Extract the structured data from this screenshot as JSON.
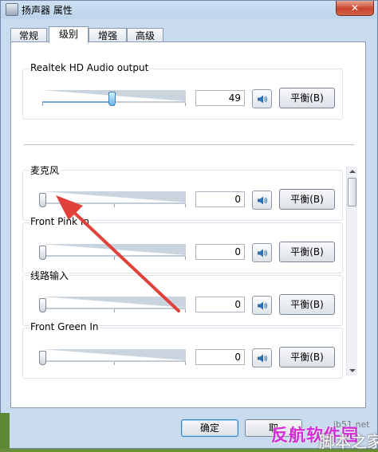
{
  "window": {
    "title": "扬声器 属性",
    "close_label": "✕"
  },
  "tabs": [
    {
      "label": "常规",
      "active": false
    },
    {
      "label": "级别",
      "active": true
    },
    {
      "label": "增强",
      "active": false
    },
    {
      "label": "高级",
      "active": false
    }
  ],
  "master": {
    "label": "Realtek HD Audio output",
    "value": "49",
    "level_percent": 49,
    "balance_label": "平衡(B)"
  },
  "channels": [
    {
      "label": "麦克风",
      "value": "0",
      "level_percent": 0,
      "balance_label": "平衡(B)"
    },
    {
      "label": "Front Pink In",
      "value": "0",
      "level_percent": 0,
      "balance_label": "平衡(B)"
    },
    {
      "label": "线路输入",
      "value": "0",
      "level_percent": 0,
      "balance_label": "平衡(B)"
    },
    {
      "label": "Front Green In",
      "value": "0",
      "level_percent": 0,
      "balance_label": "平衡(B)"
    }
  ],
  "buttons": {
    "ok": "确定",
    "cancel": "取"
  },
  "watermark": {
    "url": "jb51.net",
    "text": "脚本之家",
    "sub": "反航软件园"
  },
  "colors": {
    "annotation_arrow": "#e0413a",
    "title_bar": "#bcd4ec",
    "close_button": "#c7452c"
  },
  "icons": {
    "speaker": "speaker-icon",
    "app": "speaker-app-icon"
  }
}
